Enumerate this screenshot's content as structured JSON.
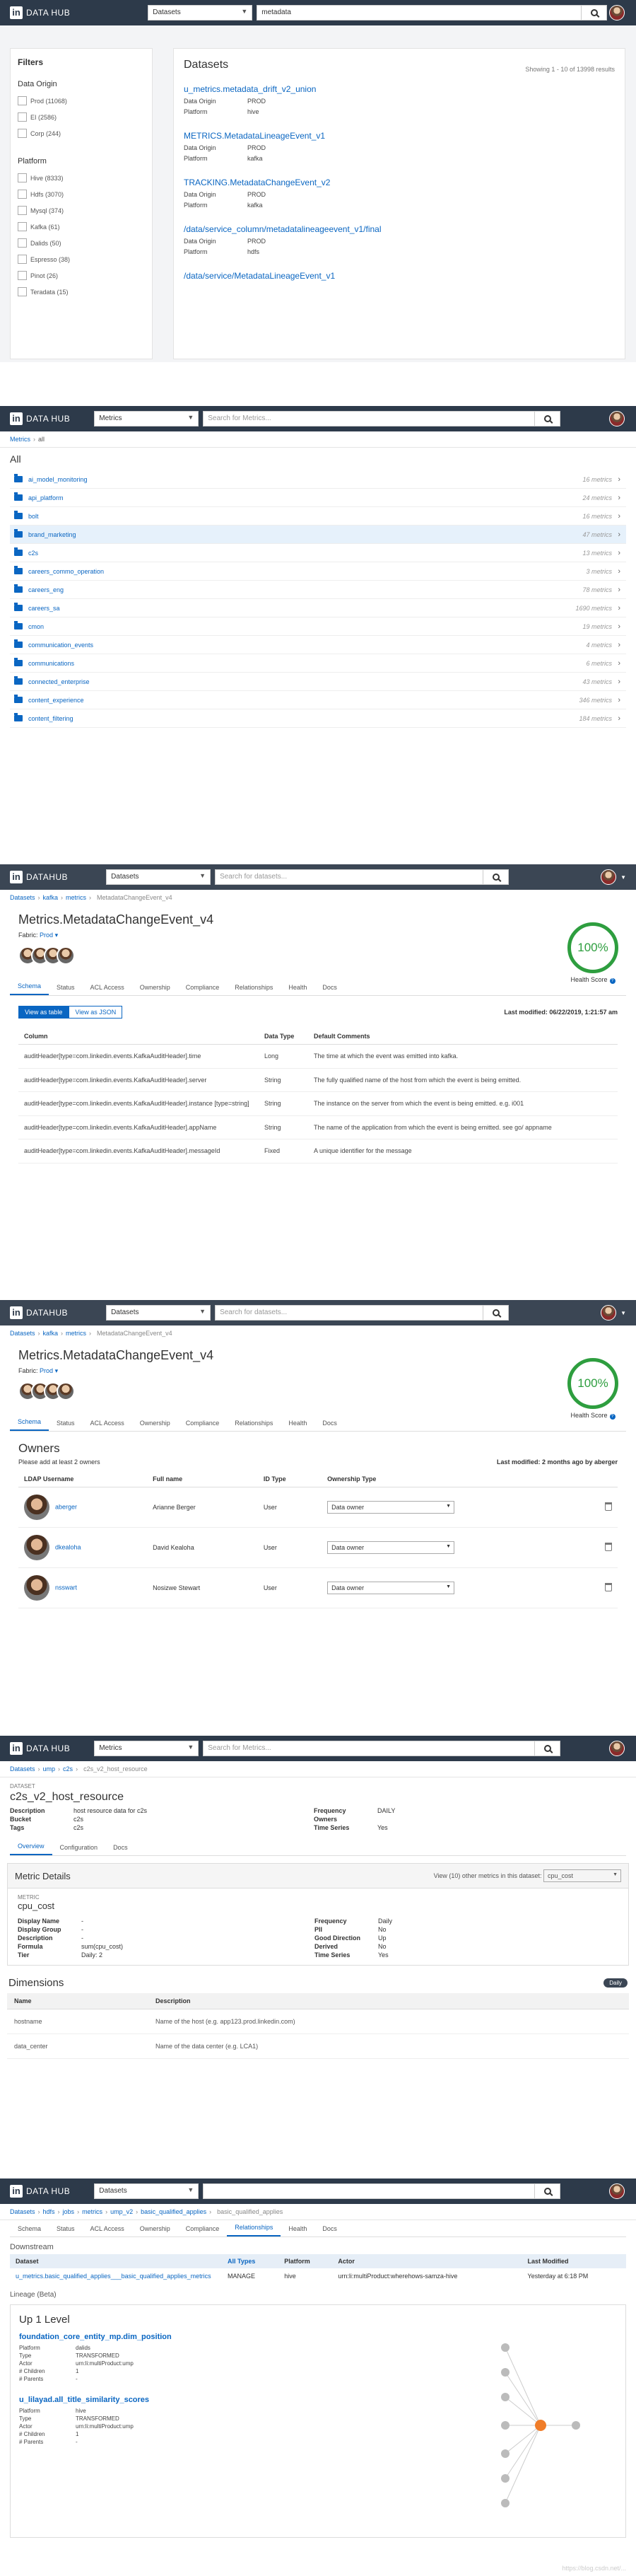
{
  "brand": "DATA HUB",
  "p1": {
    "select": "Datasets",
    "query": "metadata",
    "title": "Datasets",
    "count": "Showing 1 - 10 of 13998 results",
    "filters_title": "Filters",
    "origin_title": "Data Origin",
    "origins": [
      "Prod (11068)",
      "EI (2586)",
      "Corp (244)"
    ],
    "platform_title": "Platform",
    "platforms": [
      "Hive (8333)",
      "Hdfs (3070)",
      "Mysql (374)",
      "Kafka (61)",
      "Dalids (50)",
      "Espresso (38)",
      "Pinot (26)",
      "Teradata (15)"
    ],
    "results": [
      {
        "name": "u_metrics.metadata_drift_v2_union",
        "rows": [
          [
            "Data Origin",
            "PROD"
          ],
          [
            "Platform",
            "hive"
          ]
        ]
      },
      {
        "name": "METRICS.MetadataLineageEvent_v1",
        "rows": [
          [
            "Data Origin",
            "PROD"
          ],
          [
            "Platform",
            "kafka"
          ]
        ]
      },
      {
        "name": "TRACKING.MetadataChangeEvent_v2",
        "rows": [
          [
            "Data Origin",
            "PROD"
          ],
          [
            "Platform",
            "kafka"
          ]
        ]
      },
      {
        "name": "/data/service_column/metadatalineageevent_v1/final",
        "rows": [
          [
            "Data Origin",
            "PROD"
          ],
          [
            "Platform",
            "hdfs"
          ]
        ]
      },
      {
        "name": "/data/service/MetadataLineageEvent_v1",
        "rows": []
      }
    ]
  },
  "p2": {
    "select": "Metrics",
    "placeholder": "Search for Metrics...",
    "crumb": [
      "Metrics",
      "all"
    ],
    "title": "All",
    "rows": [
      {
        "n": "ai_model_monitoring",
        "c": "16 metrics"
      },
      {
        "n": "api_platform",
        "c": "24 metrics"
      },
      {
        "n": "bolt",
        "c": "16 metrics"
      },
      {
        "n": "brand_marketing",
        "c": "47 metrics"
      },
      {
        "n": "c2s",
        "c": "13 metrics"
      },
      {
        "n": "careers_commo_operation",
        "c": "3 metrics"
      },
      {
        "n": "careers_eng",
        "c": "78 metrics"
      },
      {
        "n": "careers_sa",
        "c": "1690 metrics"
      },
      {
        "n": "cmon",
        "c": "19 metrics"
      },
      {
        "n": "communication_events",
        "c": "4 metrics"
      },
      {
        "n": "communications",
        "c": "6 metrics"
      },
      {
        "n": "connected_enterprise",
        "c": "43 metrics"
      },
      {
        "n": "content_experience",
        "c": "346 metrics"
      },
      {
        "n": "content_filtering",
        "c": "184 metrics"
      }
    ]
  },
  "p3": {
    "brand": "DATAHUB",
    "select": "Datasets",
    "placeholder": "Search for datasets...",
    "crumb": [
      "Datasets",
      "kafka",
      "metrics",
      "MetadataChangeEvent_v4"
    ],
    "title": "Metrics.MetadataChangeEvent_v4",
    "fabric_label": "Fabric:",
    "fabric": "Prod",
    "score": "100%",
    "score_label": "Health Score",
    "tabs": [
      "Schema",
      "Status",
      "ACL Access",
      "Ownership",
      "Compliance",
      "Relationships",
      "Health",
      "Docs"
    ],
    "view_table": "View as table",
    "view_json": "View as JSON",
    "modified": "Last modified: 06/22/2019, 1:21:57 am",
    "cols": [
      "Column",
      "Data Type",
      "Default Comments"
    ],
    "rows": [
      [
        "auditHeader[type=com.linkedin.events.KafkaAuditHeader].time",
        "Long",
        "The time at which the event was emitted into kafka."
      ],
      [
        "auditHeader[type=com.linkedin.events.KafkaAuditHeader].server",
        "String",
        "The fully qualified name of the host from which the event is being emitted."
      ],
      [
        "auditHeader[type=com.linkedin.events.KafkaAuditHeader].instance [type=string]",
        "String",
        "The instance on the server from which the event is being emitted. e.g. i001"
      ],
      [
        "auditHeader[type=com.linkedin.events.KafkaAuditHeader].appName",
        "String",
        "The name of the application from which the event is being emitted. see go/ appname"
      ],
      [
        "auditHeader[type=com.linkedin.events.KafkaAuditHeader].messageId",
        "Fixed",
        "A unique identifier for the message"
      ]
    ]
  },
  "p4": {
    "owners_title": "Owners",
    "hint": "Please add at least 2 owners",
    "modified": "Last modified: 2 months ago by aberger",
    "cols": [
      "LDAP Username",
      "Full name",
      "ID Type",
      "Ownership Type"
    ],
    "rows": [
      [
        "aberger",
        "Arianne Berger",
        "User",
        "Data owner"
      ],
      [
        "dkealoha",
        "David Kealoha",
        "User",
        "Data owner"
      ],
      [
        "nsswart",
        "Nosizwe Stewart",
        "User",
        "Data owner"
      ]
    ]
  },
  "p5": {
    "select": "Metrics",
    "placeholder": "Search for Metrics...",
    "crumb": [
      "Datasets",
      "ump",
      "c2s",
      "c2s_v2_host_resource"
    ],
    "label": "DATASET",
    "title": "c2s_v2_host_resource",
    "left": [
      [
        "Description",
        "host resource data for c2s"
      ],
      [
        "Bucket",
        "c2s"
      ],
      [
        "Tags",
        "c2s"
      ]
    ],
    "right": [
      [
        "Frequency",
        "DAILY"
      ],
      [
        "Owners",
        ""
      ],
      [
        "Time Series",
        "Yes"
      ]
    ],
    "tabs": [
      "Overview",
      "Configuration",
      "Docs"
    ],
    "md_title": "Metric Details",
    "md_view": "View (10) other metrics in this dataset:",
    "md_sel": "cpu_cost",
    "metric_label": "METRIC",
    "metric": "cpu_cost",
    "mleft": [
      [
        "Display Name",
        "-"
      ],
      [
        "Display Group",
        "-"
      ],
      [
        "Description",
        "-"
      ],
      [
        "Formula",
        "sum(cpu_cost)"
      ],
      [
        "Tier",
        "Daily: 2"
      ]
    ],
    "mright": [
      [
        "Frequency",
        "Daily"
      ],
      [
        "PII",
        "No"
      ],
      [
        "Good Direction",
        "Up"
      ],
      [
        "Derived",
        "No"
      ],
      [
        "Time Series",
        "Yes"
      ]
    ],
    "dim_title": "Dimensions",
    "daily": "Daily",
    "dim_cols": [
      "Name",
      "Description"
    ],
    "dims": [
      [
        "hostname",
        "Name of the host (e.g. app123.prod.linkedin.com)"
      ],
      [
        "data_center",
        "Name of the data center (e.g. LCA1)"
      ]
    ]
  },
  "p6": {
    "select": "Datasets",
    "crumb": [
      "Datasets",
      "hdfs",
      "jobs",
      "metrics",
      "ump_v2",
      "basic_qualified_applies",
      "basic_qualified_applies"
    ],
    "tabs": [
      "Schema",
      "Status",
      "ACL Access",
      "Ownership",
      "Compliance",
      "Relationships",
      "Health",
      "Docs"
    ],
    "down": "Downstream",
    "cols": [
      "Dataset",
      "All Types",
      "Platform",
      "Actor",
      "Last Modified"
    ],
    "row": [
      "u_metrics.basic_qualified_applies___basic_qualified_applies_metrics",
      "MANAGE",
      "hive",
      "urn:li:multiProduct:wherehows-samza-hive",
      "Yesterday at 6:18 PM"
    ],
    "lineage": "Lineage (Beta)",
    "up": "Up 1 Level",
    "items": [
      {
        "name": "foundation_core_entity_mp.dim_position",
        "rows": [
          [
            "Platform",
            "dalids"
          ],
          [
            "Type",
            "TRANSFORMED"
          ],
          [
            "Actor",
            "urn:li:multiProduct:ump"
          ],
          [
            "# Children",
            "1"
          ],
          [
            "# Parents",
            "-"
          ]
        ]
      },
      {
        "name": "u_lilayad.all_title_similarity_scores",
        "rows": [
          [
            "Platform",
            "hive"
          ],
          [
            "Type",
            "TRANSFORMED"
          ],
          [
            "Actor",
            "urn:li:multiProduct:ump"
          ],
          [
            "# Children",
            "1"
          ],
          [
            "# Parents",
            "-"
          ]
        ]
      }
    ],
    "watermark": "https://blog.csdn.net/..."
  },
  "colors": {
    "header": "#2d3a4a",
    "accent": "#0a66c2",
    "health": "#2e9e3f"
  }
}
